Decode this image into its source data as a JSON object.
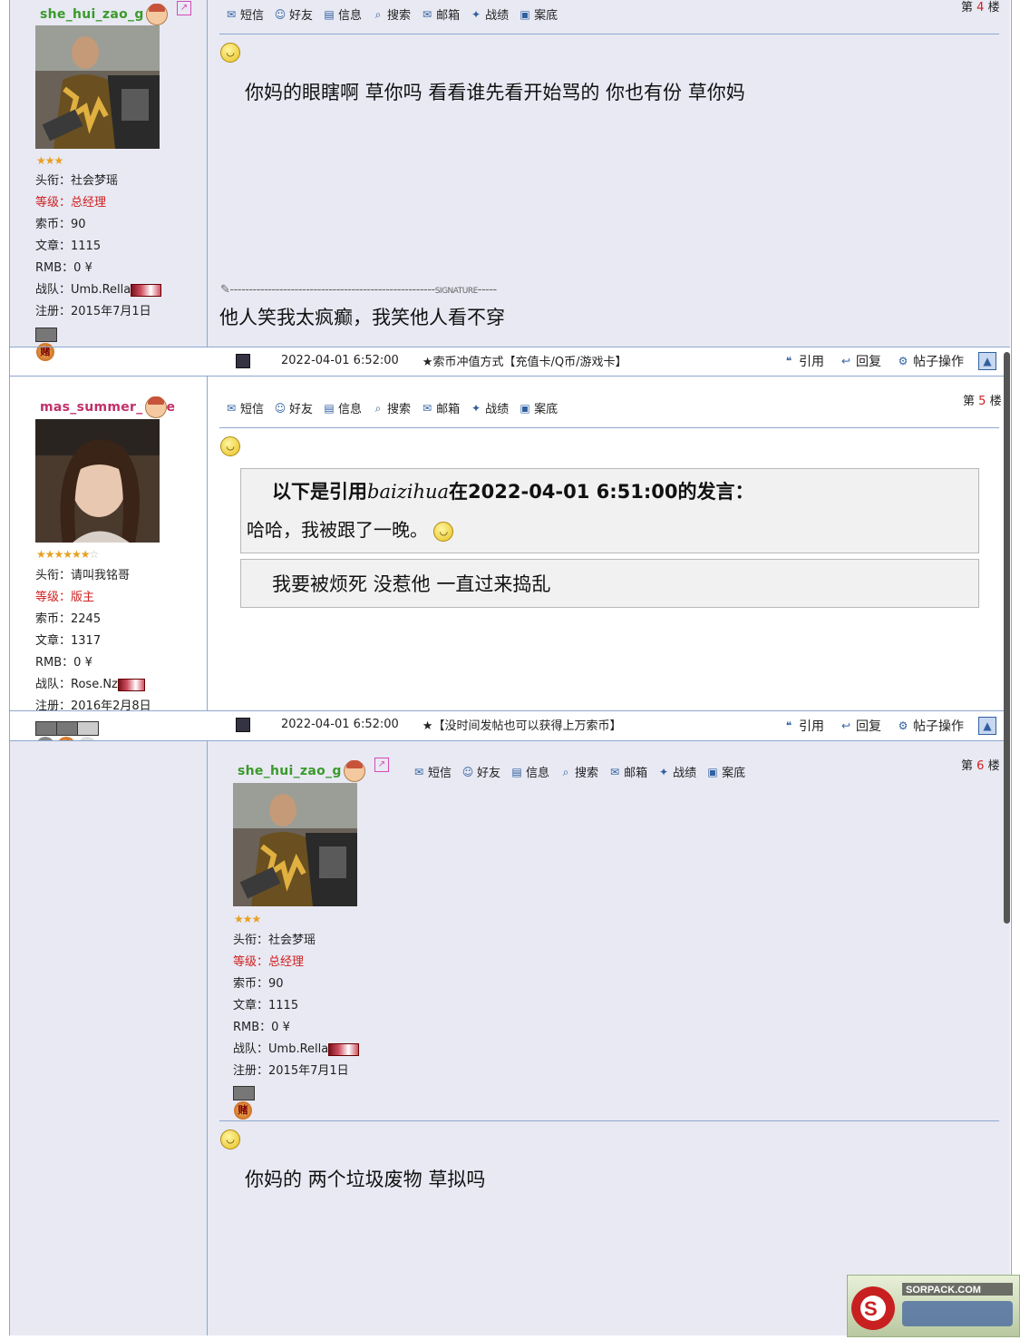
{
  "posts": [
    {
      "username": "she_hui_zao_g",
      "stars": "★★★",
      "title_label": "头衔：",
      "title_value": "社会梦瑶",
      "level_label": "等级：",
      "level_value": "总经理",
      "coins_label": "索币：",
      "coins_value": "90",
      "articles_label": "文章：",
      "articles_value": "1115",
      "rmb_label": "RMB：",
      "rmb_value": "0 ¥",
      "team_label": "战队：",
      "team_value": "Umb.Rella",
      "reg_label": "注册：",
      "reg_value": "2015年7月1日",
      "medal_text": "赌",
      "floor_prefix": "第",
      "floor_num": "4",
      "floor_suffix": "楼",
      "message": "你妈的眼瞎啊 草你吗   看看谁先看开始骂的 你也有份 草你妈",
      "signature_label": "SIGNATURE",
      "signature": "他人笑我太疯癫，我笑他人看不穿",
      "post_time": "2022-04-01 6:52:00",
      "ad_text": "★索币冲值方式【充值卡/Q币/游戏卡】"
    },
    {
      "username": "mas_summer_",
      "username_tail": "e",
      "stars": "★★★★★★",
      "stars_empty": "☆",
      "title_label": "头衔：",
      "title_value": "请叫我铭哥",
      "level_label": "等级：",
      "level_value": "版主",
      "coins_label": "索币：",
      "coins_value": "2245",
      "articles_label": "文章：",
      "articles_value": "1317",
      "rmb_label": "RMB：",
      "rmb_value": "0 ¥",
      "team_label": "战队：",
      "team_value": "Rose.Nz",
      "reg_label": "注册：",
      "reg_value": "2016年2月8日",
      "medal_text": "赌",
      "floor_prefix": "第",
      "floor_num": "5",
      "floor_suffix": "楼",
      "quote_header_prefix": "以下是引用",
      "quote_author": "baizihua",
      "quote_header_suffix": "在2022-04-01 6:51:00的发言：",
      "quote_text": "哈哈，我被跟了一晚。",
      "reply_text": "我要被烦死 没惹他 一直过来捣乱",
      "post_time": "2022-04-01 6:52:00",
      "ad_text": "★【没时间发帖也可以获得上万索币】"
    },
    {
      "username": "she_hui_zao_g",
      "stars": "★★★",
      "title_label": "头衔：",
      "title_value": "社会梦瑶",
      "level_label": "等级：",
      "level_value": "总经理",
      "coins_label": "索币：",
      "coins_value": "90",
      "articles_label": "文章：",
      "articles_value": "1115",
      "rmb_label": "RMB：",
      "rmb_value": "0 ¥",
      "team_label": "战队：",
      "team_value": "Umb.Rella",
      "reg_label": "注册：",
      "reg_value": "2015年7月1日",
      "medal_text": "赌",
      "floor_prefix": "第",
      "floor_num": "6",
      "floor_suffix": "楼",
      "message": "你妈的 两个垃圾废物 草拟吗"
    }
  ],
  "toolbar": {
    "sms": "短信",
    "friend": "好友",
    "info": "信息",
    "search": "搜索",
    "mail": "邮箱",
    "record": "战绩",
    "case": "案底"
  },
  "footer": {
    "quote": "引用",
    "reply": "回复",
    "manage": "帖子操作"
  },
  "watermark": "SORPACK.COM"
}
